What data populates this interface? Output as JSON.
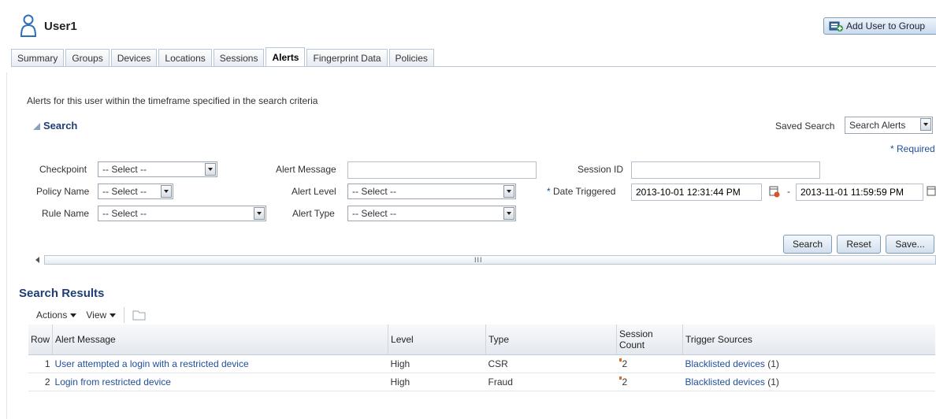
{
  "header": {
    "user_name": "User1",
    "add_user_button": "Add User to Group"
  },
  "tabs": [
    {
      "label": "Summary",
      "active": false
    },
    {
      "label": "Groups",
      "active": false
    },
    {
      "label": "Devices",
      "active": false
    },
    {
      "label": "Locations",
      "active": false
    },
    {
      "label": "Sessions",
      "active": false
    },
    {
      "label": "Alerts",
      "active": true
    },
    {
      "label": "Fingerprint Data",
      "active": false
    },
    {
      "label": "Policies",
      "active": false
    }
  ],
  "description": "Alerts for this user within the timeframe specified in the search criteria",
  "search": {
    "title": "Search",
    "saved_search_label": "Saved Search",
    "saved_search_value": "Search Alerts",
    "required_note": "* Required",
    "fields": {
      "checkpoint_label": "Checkpoint",
      "checkpoint_value": "-- Select --",
      "policy_name_label": "Policy Name",
      "policy_name_value": "-- Select --",
      "rule_name_label": "Rule Name",
      "rule_name_value": "-- Select --",
      "alert_message_label": "Alert Message",
      "alert_message_value": "",
      "alert_level_label": "Alert Level",
      "alert_level_value": "-- Select --",
      "alert_type_label": "Alert Type",
      "alert_type_value": "-- Select --",
      "session_id_label": "Session ID",
      "session_id_value": "",
      "date_triggered_label": "Date Triggered",
      "date_from": "2013-10-01 12:31:44 PM",
      "date_separator": "-",
      "date_to": "2013-11-01 11:59:59 PM"
    },
    "buttons": {
      "search": "Search",
      "reset": "Reset",
      "save": "Save..."
    },
    "scroll_grip": "III"
  },
  "results": {
    "title": "Search Results",
    "actions_label": "Actions",
    "view_label": "View",
    "columns": [
      "Row",
      "Alert Message",
      "Level",
      "Type",
      "Session Count",
      "Trigger Sources"
    ],
    "rows": [
      {
        "row": "1",
        "message": "User attempted a login with a restricted device",
        "level": "High",
        "type": "CSR",
        "session_count": "2",
        "trigger_source": "Blacklisted devices",
        "trigger_count": "(1)"
      },
      {
        "row": "2",
        "message": "Login from restricted device",
        "level": "High",
        "type": "Fraud",
        "session_count": "2",
        "trigger_source": "Blacklisted devices",
        "trigger_count": "(1)"
      }
    ]
  },
  "colors": {
    "link": "#1f4e9a",
    "heading": "#1f3f73",
    "flag": "#e26a1a"
  }
}
